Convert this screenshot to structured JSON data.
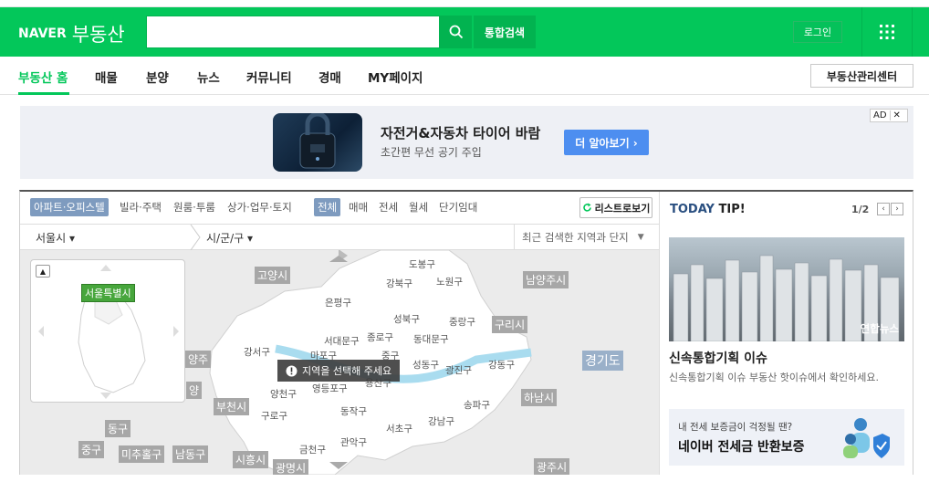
{
  "header": {
    "logo_brand": "NAVER",
    "logo_service": "부동산",
    "search_value": "",
    "search_button": "통합검색",
    "login": "로그인"
  },
  "nav": {
    "items": [
      "부동산 홈",
      "매물",
      "분양",
      "뉴스",
      "커뮤니티",
      "경매",
      "MY페이지"
    ],
    "active": "부동산 홈",
    "right_button": "부동산관리센터"
  },
  "ad": {
    "title": "자전거&자동차 타이어 바람",
    "subtitle": "초간편 무선 공기 주입",
    "button": "더 알아보기 ›",
    "badge": "AD",
    "close": "✕"
  },
  "filters": {
    "property_types": [
      "아파트·오피스텔",
      "빌라·주택",
      "원룸·투룸",
      "상가·업무·토지"
    ],
    "deal_types": [
      "전체",
      "매매",
      "전세",
      "월세",
      "단기임대"
    ],
    "list_view": "리스트로보기"
  },
  "region": {
    "city": "서울시",
    "district": "시/군/구",
    "recent": "최근 검색한 지역과 단지"
  },
  "map": {
    "mini_label": "서울특별시",
    "message": "지역을 선택해 주세요",
    "cities": [
      "고양시",
      "남양주시",
      "구리시",
      "경기도",
      "하남시",
      "부천시",
      "광명시",
      "시흥시",
      "광주시",
      "양주",
      "동구",
      "중구",
      "미추홀구",
      "남동구",
      "양"
    ],
    "districts": [
      "도봉구",
      "강북구",
      "노원구",
      "은평구",
      "성북구",
      "중랑구",
      "서대문구",
      "종로구",
      "동대문구",
      "마포구",
      "중구",
      "성동구",
      "광진구",
      "강동구",
      "강서구",
      "용산구",
      "양천구",
      "영등포구",
      "동작구",
      "송파구",
      "구로구",
      "서초구",
      "강남구",
      "금천구",
      "관악구"
    ]
  },
  "tip": {
    "title_prefix": "TODAY",
    "title_suffix": "TIP!",
    "page": "1/2",
    "image_credit": "연합뉴스",
    "headline": "신속통합기획 이슈",
    "description": "신속통합기획 이슈 부동산 핫이슈에서 확인하세요.",
    "guard_small": "내 전세 보증금이 걱정될 땐?",
    "guard_big": "네이버 전세금 반환보증"
  },
  "colors": {
    "brand_green": "#03c75a",
    "ad_button": "#4d8ef0"
  }
}
